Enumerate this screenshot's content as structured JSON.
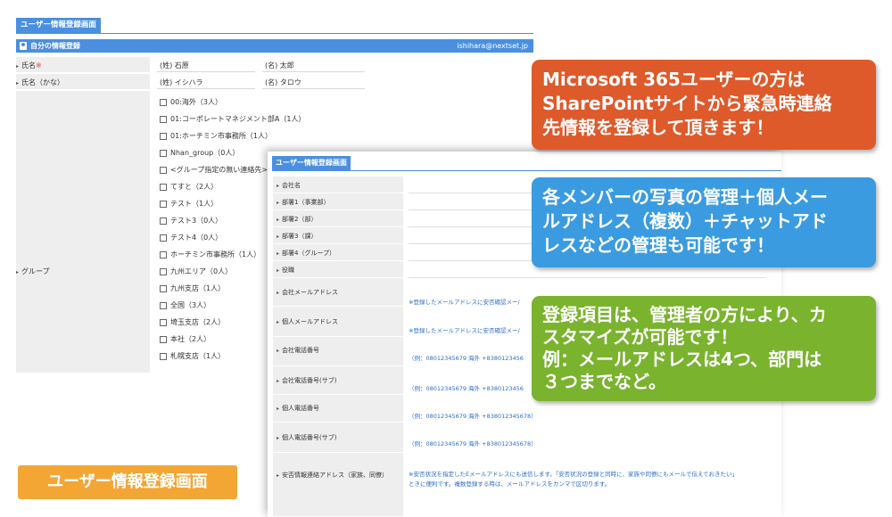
{
  "back_panel": {
    "tab": "ユーザー情報登録画面",
    "section_title": "自分の情報登録",
    "email": "ishihara@nextset.jp",
    "name_label": "氏名",
    "required_mark": "※",
    "kana_label": "氏名（かな）",
    "surname_prefix": "(姓)",
    "given_prefix": "(名)",
    "surname": "石原",
    "given_name": "太郎",
    "surname_kana": "イシハラ",
    "given_kana": "タロウ",
    "group_label": "グループ",
    "groups": [
      "00:海外（3人）",
      "01:コーポレートマネジメント部A（1人）",
      "01:ホーチミン市事務所（1人）",
      "Nhan_group（0人）",
      "<グループ指定の無い連絡先>（3",
      "てすと（2人）",
      "テスト（1人）",
      "テスト3（0人）",
      "テスト4（0人）",
      "ホーチミン市事務所（1人）",
      "九州エリア（0人）",
      "九州支店（1人）",
      "全国（3人）",
      "埼玉支店（2人）",
      "本社（2人）",
      "札幌支店（1人）"
    ]
  },
  "front_panel": {
    "tab": "ユーザー情報登録画面",
    "fields": [
      "会社名",
      "部署1（事業部）",
      "部署2（部）",
      "部署3（課）",
      "部署4（グループ）",
      "役職",
      "会社メールアドレス",
      "個人メールアドレス",
      "会社電話番号",
      "会社電話番号(サブ)",
      "個人電話番号",
      "個人電話番号(サブ)",
      "安否情報連絡アドレス（家族、同僚）"
    ],
    "mail_note": "※登録したメールアドレスに安否確認メー/",
    "phone_hint_cut": "（例：08012345679 海外 +8380123456",
    "phone_hint": "（例：08012345679 海外 +838012345678）",
    "safety_note_1": "※安否状況を指定したEメールアドレスにも送信します。「安否状況の登録と同時に、家族や同僚にもメールで伝えておきたい」",
    "safety_note_2": "ときに便利です。複数登録する時は、メールアドレスをカンマで区切ります。"
  },
  "callouts": {
    "red": [
      "Microsoft 365ユーザーの方は",
      "SharePointサイトから緊急時連絡",
      "先情報を登録して頂きます！"
    ],
    "blue": [
      "各メンバーの写真の管理＋個人メー",
      "ルアドレス（複数）＋チャットアド",
      "レスなどの管理も可能です！"
    ],
    "green": [
      "登録項目は、管理者の方により、カ",
      "スタマイズが可能です！",
      "例：メールアドレスは4つ、部門は",
      "３つまでなど。"
    ]
  },
  "badge": "ユーザー情報登録画面",
  "colors": {
    "accent_blue": "#4a8fe0",
    "callout_red": "#de5a2b",
    "callout_blue": "#3a9be0",
    "callout_green": "#7ab32e",
    "badge_orange": "#f4a634"
  }
}
